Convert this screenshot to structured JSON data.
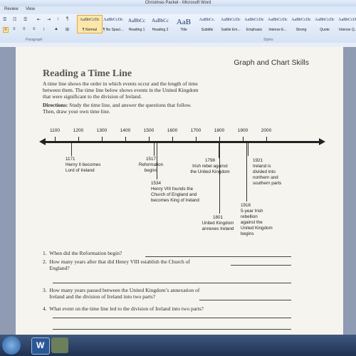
{
  "window": {
    "title": "Christmas Packet - Microsoft Word"
  },
  "menu": {
    "items": [
      "Review",
      "View"
    ]
  },
  "ribbon": {
    "group_paragraph": "Paragraph",
    "group_styles": "Styles",
    "styles": [
      {
        "sample": "AaBbCcDc",
        "name": "¶ Normal",
        "active": true
      },
      {
        "sample": "AaBbCcDc",
        "name": "¶ No Spaci..."
      },
      {
        "sample": "AaBbCc",
        "name": "Heading 1"
      },
      {
        "sample": "AaBbCc",
        "name": "Heading 2"
      },
      {
        "sample": "AaB",
        "name": "Title"
      },
      {
        "sample": "AaBbCc.",
        "name": "Subtitle"
      },
      {
        "sample": "AaBbCcDc",
        "name": "Subtle Em..."
      },
      {
        "sample": "AaBbCcDc",
        "name": "Emphasis"
      },
      {
        "sample": "AaBbCcDc",
        "name": "Intense E..."
      },
      {
        "sample": "AaBbCcDc",
        "name": "Strong"
      },
      {
        "sample": "AaBbCcDc",
        "name": "Quote"
      },
      {
        "sample": "AaBbCcDc",
        "name": "Intense Q..."
      }
    ]
  },
  "document": {
    "header_right": "Graph and Chart Skills",
    "title": "Reading a Time Line",
    "intro_1": "A time line shows the order in which events occur and the length of time",
    "intro_2": "between them. The time line below shows events in the United Kingdom",
    "intro_3": "that were significant to the division of Ireland.",
    "directions_label": "Directions:",
    "directions_1": " Study the time line, and answer the questions that follow.",
    "directions_2": "Then, draw your own time line.",
    "timeline": {
      "years": [
        "1100",
        "1200",
        "1300",
        "1400",
        "1500",
        "1600",
        "1700",
        "1800",
        "1900",
        "2000"
      ],
      "events": [
        {
          "text": "1171\nHenry II becomes\nLord of Ireland"
        },
        {
          "text": "1517\nReformation\nbegins"
        },
        {
          "text": "1534\nHenry VIII founds the\nChurch of England and\nbecomes King of Ireland"
        },
        {
          "text": "1798\nIrish rebel against\nthe United Kingdom"
        },
        {
          "text": "1801\nUnited Kingdom\nannexes Ireland"
        },
        {
          "text": "1916\n5-year Irish\nrebellion\nagainst the\nUnited Kingdom\nbegins"
        },
        {
          "text": "1921\nIreland is\ndivided into\nnorthern and\nsouthern parts"
        }
      ]
    },
    "questions": [
      "1.  When did the Reformation begin?",
      "2.  How many years after that did Henry VIII establish the Church of\n     England?",
      "3.  How many years passed between the United Kingdom’s annexation of\n     Ireland and the division of Ireland into two parts?",
      "4.  What event on the time line led to the division of Ireland into two parts?"
    ]
  }
}
